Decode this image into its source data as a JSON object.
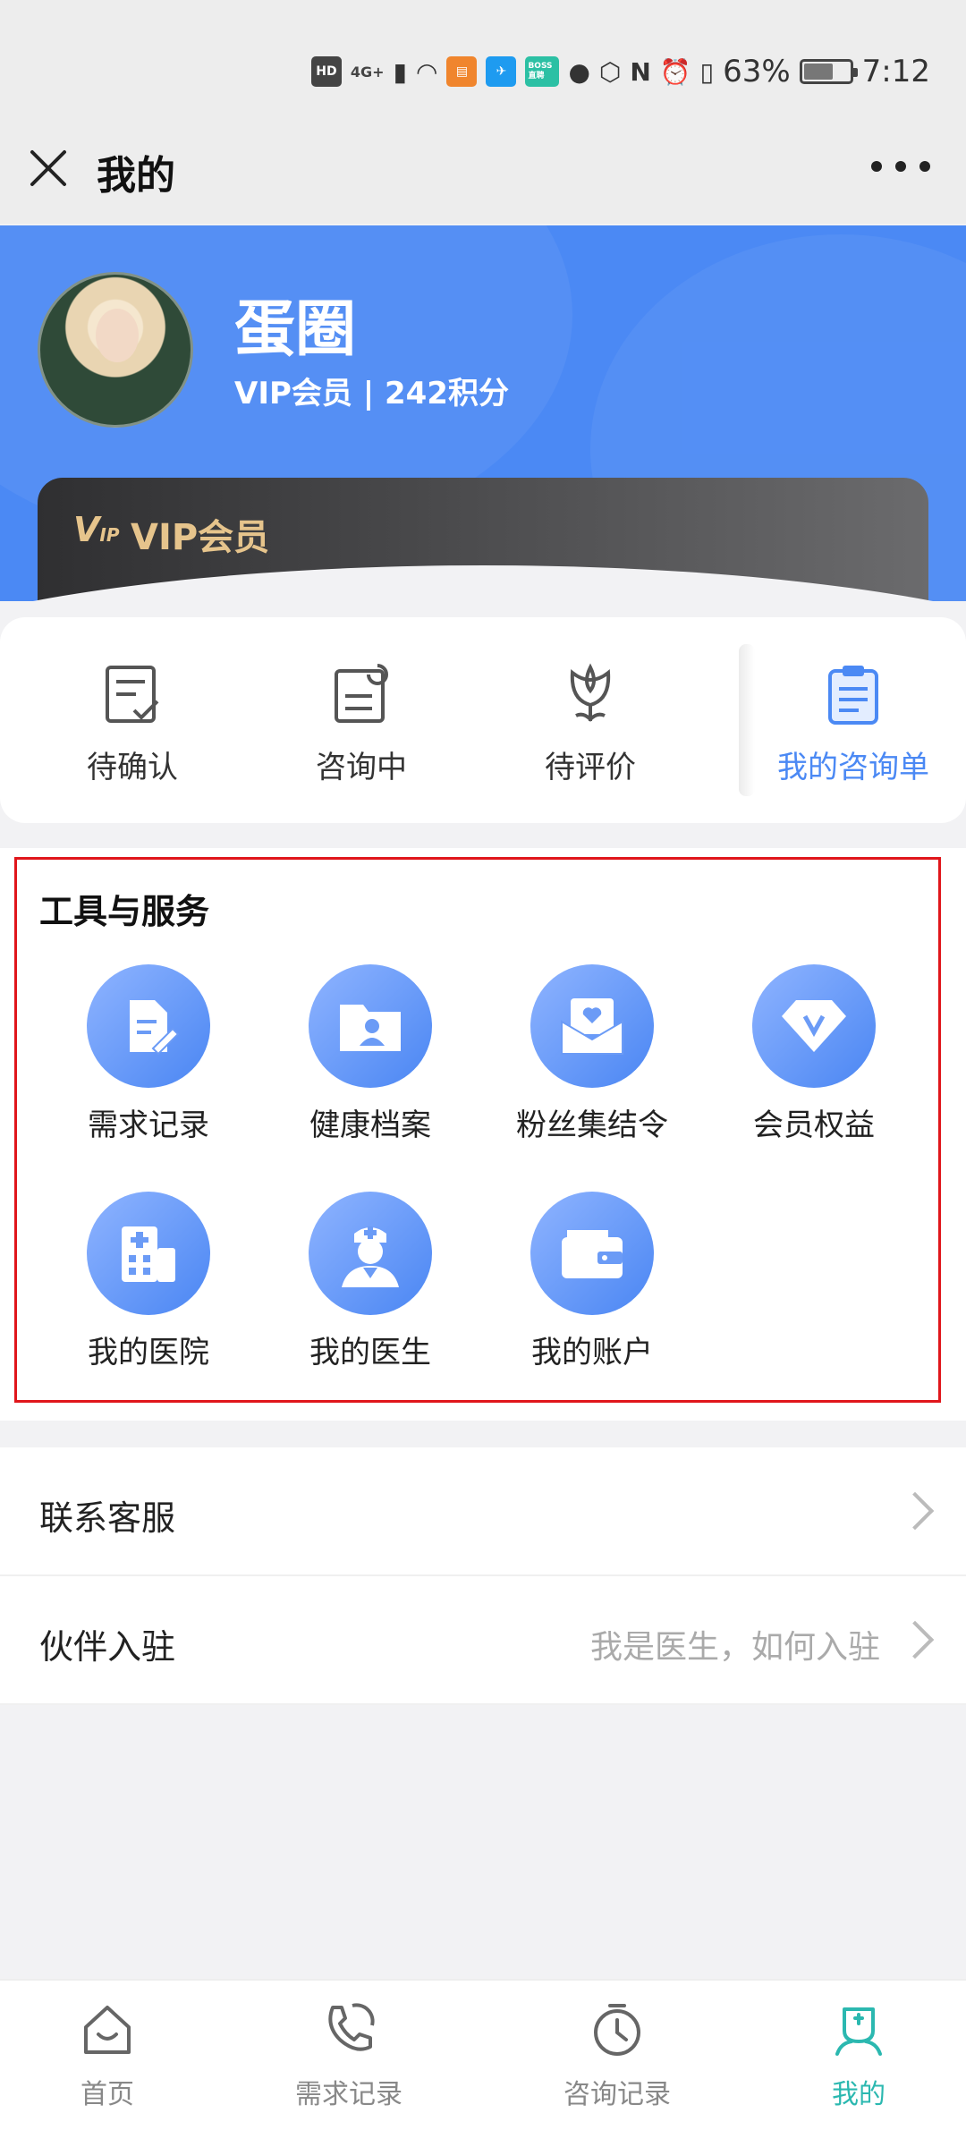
{
  "status_bar": {
    "hd": "HD",
    "network": "4G+",
    "boss_label": "BOSS直聘",
    "battery_percent_text": "63%",
    "battery_level": 0.63,
    "time": "7:12"
  },
  "titlebar": {
    "title": "我的"
  },
  "profile": {
    "username": "蛋圈",
    "member_line": "VIP会员 | 242积分",
    "vip_card_label": "VIP会员",
    "vip_logo": "VIP"
  },
  "orders": [
    {
      "label": "待确认",
      "icon": "pending-confirm-icon"
    },
    {
      "label": "咨询中",
      "icon": "consulting-icon"
    },
    {
      "label": "待评价",
      "icon": "pending-review-icon"
    },
    {
      "label": "我的咨询单",
      "icon": "clipboard-icon"
    }
  ],
  "tools": {
    "title": "工具与服务",
    "items": [
      {
        "label": "需求记录",
        "icon": "document-edit-icon"
      },
      {
        "label": "健康档案",
        "icon": "folder-user-icon"
      },
      {
        "label": "粉丝集结令",
        "icon": "heart-envelope-icon"
      },
      {
        "label": "会员权益",
        "icon": "diamond-v-icon"
      },
      {
        "label": "我的医院",
        "icon": "hospital-icon"
      },
      {
        "label": "我的医生",
        "icon": "doctor-icon"
      },
      {
        "label": "我的账户",
        "icon": "wallet-icon"
      }
    ]
  },
  "list": {
    "contact": {
      "label": "联系客服"
    },
    "partner": {
      "label": "伙伴入驻",
      "hint": "我是医生，如何入驻"
    }
  },
  "tabbar": [
    {
      "label": "首页",
      "icon": "home-icon"
    },
    {
      "label": "需求记录",
      "icon": "phone-chat-icon"
    },
    {
      "label": "咨询记录",
      "icon": "clock-icon"
    },
    {
      "label": "我的",
      "icon": "user-medical-icon",
      "active": true
    }
  ],
  "colors": {
    "accent": "#4b89f4",
    "tab_active": "#2bb8b0",
    "vip_gold": "#e6c48c",
    "highlight_border": "#e0161b"
  }
}
